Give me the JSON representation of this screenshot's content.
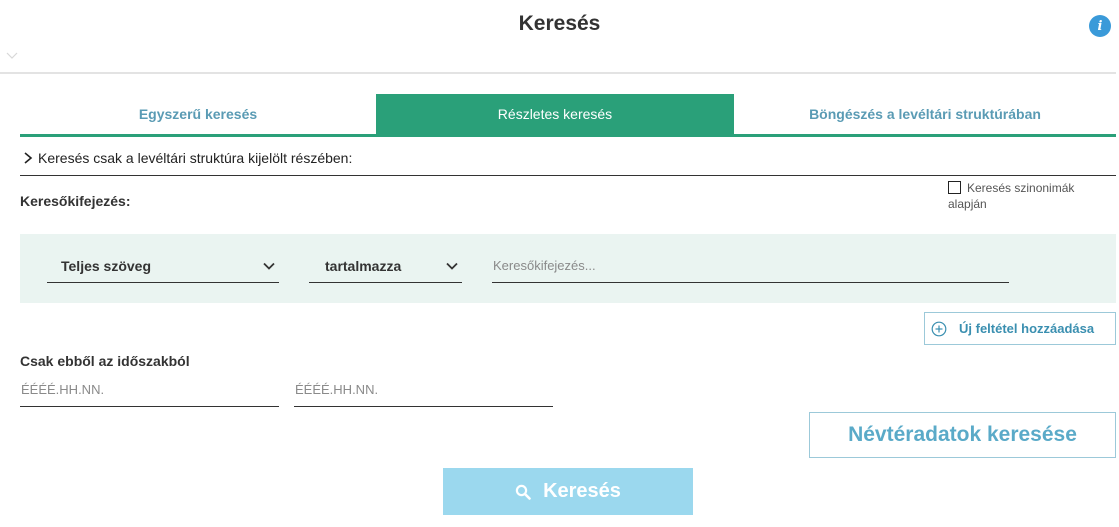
{
  "header": {
    "title": "Keresés",
    "info_symbol": "i"
  },
  "tabs": [
    {
      "label": "Egyszerű keresés",
      "active": false
    },
    {
      "label": "Részletes keresés",
      "active": true
    },
    {
      "label": "Böngészés a levéltári struktúrában",
      "active": false
    }
  ],
  "scope": {
    "label": "Keresés csak a levéltári struktúra kijelölt részében:"
  },
  "expression": {
    "label": "Keresőkifejezés:",
    "synonym_label": "Keresés szinonimák alapján",
    "synonym_checked": false
  },
  "criteria": {
    "field_value": "Teljes szöveg",
    "operator_value": "tartalmazza",
    "input_placeholder": "Keresőkifejezés...",
    "input_value": ""
  },
  "add_condition_label": "Új feltétel hozzáadása",
  "period": {
    "label": "Csak ebből az időszakból",
    "from_placeholder": "ÉÉÉÉ.HH.NN.",
    "to_placeholder": "ÉÉÉÉ.HH.NN."
  },
  "namespace_button_label": "Névtéradatok keresése",
  "search_button_label": "Keresés",
  "colors": {
    "accent_green": "#2aa079",
    "accent_blue": "#3a8fb0",
    "search_button": "#9bd8ee",
    "panel_bg": "#eaf4f1"
  },
  "icons": {
    "info": "info-icon",
    "collapse": "chevron-down-icon",
    "scope": "chevron-right-icon",
    "add": "plus-circle-icon",
    "search": "search-icon"
  }
}
